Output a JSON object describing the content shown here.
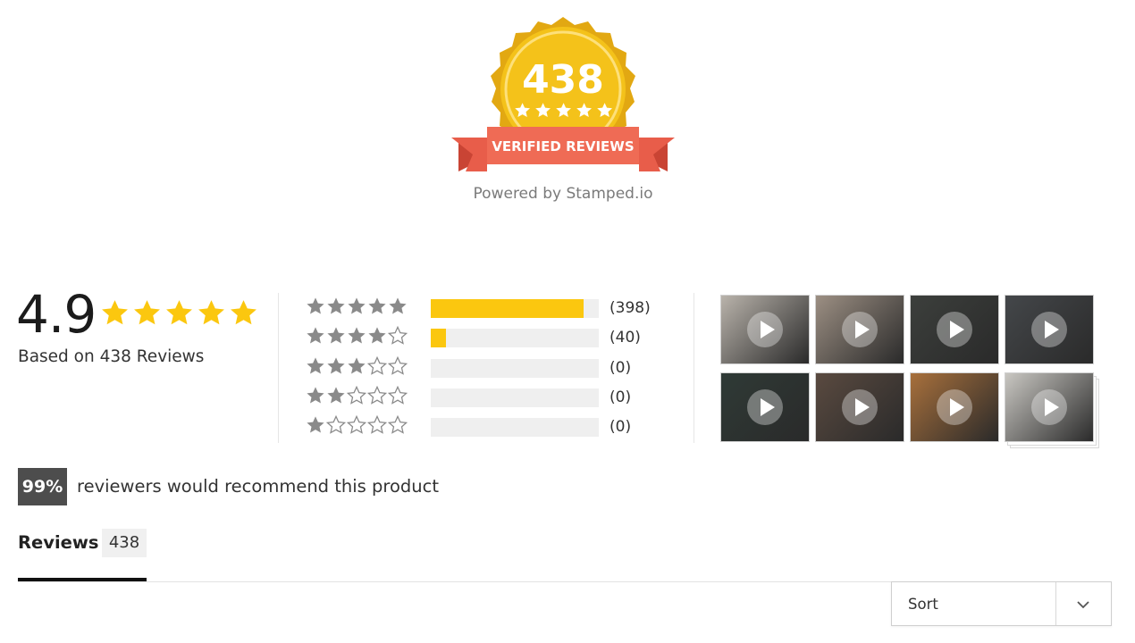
{
  "badge": {
    "count": "438",
    "ribbon_text": "VERIFIED REVIEWS",
    "powered_by": "Powered by Stamped.io",
    "colors": {
      "gold": "#f4c21a",
      "gold_dark": "#e2a812",
      "ribbon": "#e85d4a",
      "ribbon_dark": "#c94434"
    }
  },
  "summary": {
    "average": "4.9",
    "stars": 5,
    "based_on": "Based on 438 Reviews",
    "star_color": "#fbc70f"
  },
  "histogram": [
    {
      "stars": 5,
      "count_label": "(398)",
      "fraction": 0.909
    },
    {
      "stars": 4,
      "count_label": "(40)",
      "fraction": 0.091
    },
    {
      "stars": 3,
      "count_label": "(0)",
      "fraction": 0
    },
    {
      "stars": 2,
      "count_label": "(0)",
      "fraction": 0
    },
    {
      "stars": 1,
      "count_label": "(0)",
      "fraction": 0
    }
  ],
  "media": [
    {
      "kind": "video",
      "bg": "#b9b3ab"
    },
    {
      "kind": "photo",
      "bg": "#9c8f83"
    },
    {
      "kind": "video",
      "bg": "#3c3f3c"
    },
    {
      "kind": "video",
      "bg": "#44474a"
    },
    {
      "kind": "photo",
      "bg": "#2f3a36"
    },
    {
      "kind": "video",
      "bg": "#5a4a40"
    },
    {
      "kind": "photo",
      "bg": "#a8703c"
    },
    {
      "kind": "video",
      "bg": "#c9c7c2"
    }
  ],
  "recommend": {
    "percent": "99%",
    "text": "reviewers would recommend this product"
  },
  "tabs": [
    {
      "label": "Reviews",
      "count": "438",
      "active": true
    }
  ],
  "sort": {
    "label": "Sort"
  }
}
